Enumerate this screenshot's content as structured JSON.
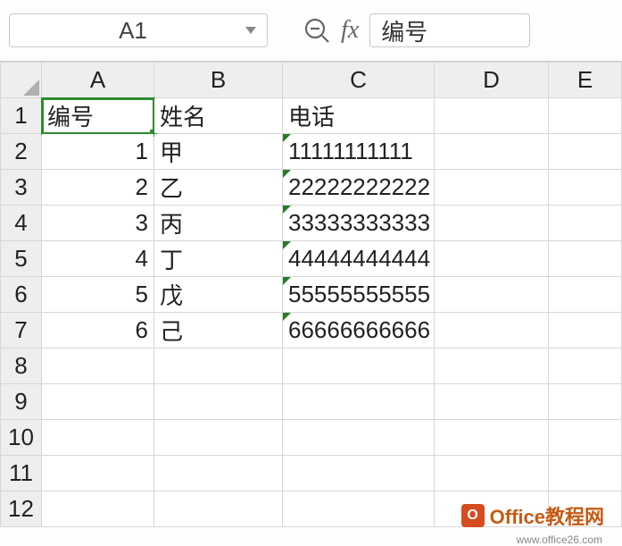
{
  "toolbar": {
    "cell_ref": "A1",
    "fx_label": "fx",
    "formula_value": "编号"
  },
  "columns": [
    "A",
    "B",
    "C",
    "D",
    "E"
  ],
  "row_numbers": [
    1,
    2,
    3,
    4,
    5,
    6,
    7,
    8,
    9,
    10,
    11,
    12
  ],
  "grid": {
    "headers": {
      "A": "编号",
      "B": "姓名",
      "C": "电话"
    },
    "rows": [
      {
        "A": "1",
        "B": "甲",
        "C": "11111111111"
      },
      {
        "A": "2",
        "B": "乙",
        "C": "22222222222"
      },
      {
        "A": "3",
        "B": "丙",
        "C": "33333333333"
      },
      {
        "A": "4",
        "B": "丁",
        "C": "44444444444"
      },
      {
        "A": "5",
        "B": "戊",
        "C": "55555555555"
      },
      {
        "A": "6",
        "B": "己",
        "C": "66666666666"
      }
    ]
  },
  "watermark": {
    "brand": "Office教程网",
    "url": "www.office26.com",
    "badge": "O"
  }
}
